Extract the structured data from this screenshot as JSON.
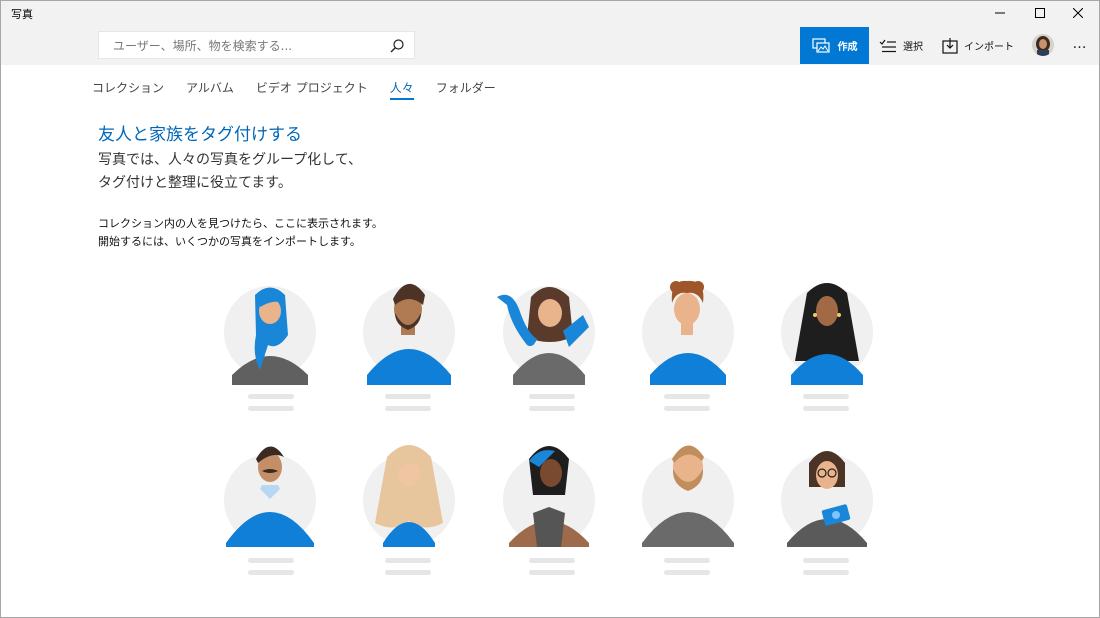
{
  "window": {
    "title": "写真"
  },
  "search": {
    "placeholder": "ユーザー、場所、物を検索する..."
  },
  "toolbar": {
    "create_label": "作成",
    "select_label": "選択",
    "import_label": "インポート",
    "more_label": "…"
  },
  "tabs": [
    {
      "label": "コレクション",
      "active": false
    },
    {
      "label": "アルバム",
      "active": false
    },
    {
      "label": "ビデオ プロジェクト",
      "active": false
    },
    {
      "label": "人々",
      "active": true
    },
    {
      "label": "フォルダー",
      "active": false
    }
  ],
  "hero": {
    "title": "友人と家族をタグ付けする",
    "subtitle_line1": "写真では、人々の写真をグループ化して、",
    "subtitle_line2": "タグ付けと整理に役立てます。"
  },
  "info": {
    "line1": "コレクション内の人を見つけたら、ここに表示されます。",
    "line2": "開始するには、いくつかの写真をインポートします。"
  },
  "colors": {
    "accent": "#0078d4",
    "accent_text": "#0067b8",
    "chrome": "#f2f2f2",
    "placeholder_bar": "#e6e6e6"
  },
  "icons": {
    "search": "search-icon",
    "create": "create-icon",
    "select": "select-list-icon",
    "import": "import-icon",
    "minimize": "minimize-icon",
    "maximize": "maximize-icon",
    "close": "close-icon"
  }
}
